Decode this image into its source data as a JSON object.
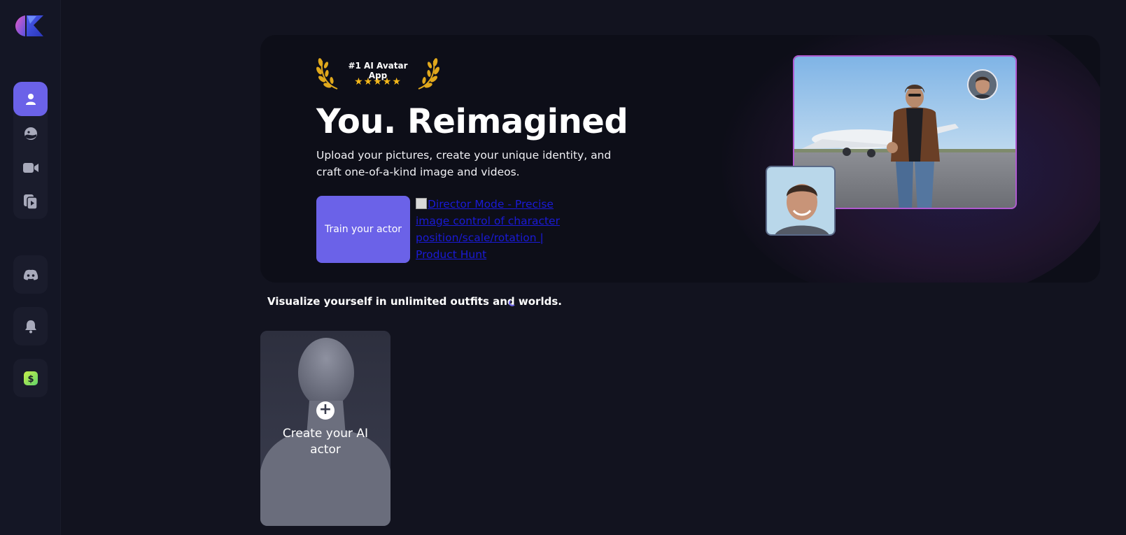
{
  "sidebar": {
    "logo": "app-logo",
    "nav_top": [
      {
        "icon": "user-icon",
        "active": true
      },
      {
        "icon": "face-image-icon",
        "active": false
      },
      {
        "icon": "video-camera-icon",
        "active": false
      },
      {
        "icon": "video-stack-icon",
        "active": false
      }
    ],
    "discord_icon": "discord-icon",
    "bell_icon": "bell-icon",
    "dollar_icon": "dollar-icon"
  },
  "hero": {
    "badge_title": "#1 AI Avatar App",
    "badge_stars": "★★★★★",
    "title": "You. Reimagined",
    "description": "Upload your pictures, create your unique identity, and craft one-of-a-kind image and videos.",
    "cta_label": "Train your actor",
    "ph_link_alt": "Director Mode - Precise image control of character position/scale/rotation | Product Hunt"
  },
  "section": {
    "title": "Visualize yourself in unlimited outfits and worlds."
  },
  "create_card": {
    "plus": "+",
    "label": "Create your AI actor"
  },
  "colors": {
    "background": "#12131f",
    "accent": "#6b62e8",
    "star": "#f5b81a",
    "link": "#1a1ad6"
  }
}
